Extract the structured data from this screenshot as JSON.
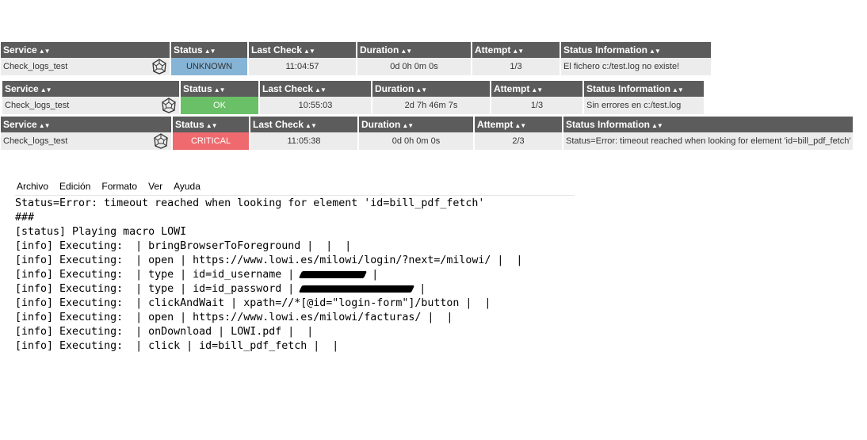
{
  "headers": {
    "service": "Service",
    "status": "Status",
    "last_check": "Last Check",
    "duration": "Duration",
    "attempt": "Attempt",
    "status_info": "Status Information"
  },
  "rows": [
    {
      "service": "Check_logs_test",
      "status": "UNKNOWN",
      "status_color": "#86b4d6",
      "last_check": "11:04:57",
      "duration": "0d 0h 0m 0s",
      "attempt": "1/3",
      "status_info": "El fichero c:/test.log no existe!"
    },
    {
      "service": "Check_logs_test",
      "status": "OK",
      "status_color": "#6ac066",
      "last_check": "10:55:03",
      "duration": "2d 7h 46m 7s",
      "attempt": "1/3",
      "status_info": "Sin errores en c:/test.log"
    },
    {
      "service": "Check_logs_test",
      "status": "CRITICAL",
      "status_color": "#ef6a6e",
      "last_check": "11:05:38",
      "duration": "0d 0h 0m 0s",
      "attempt": "2/3",
      "status_info": "Status=Error: timeout reached when looking for element 'id=bill_pdf_fetch'"
    }
  ],
  "notepad": {
    "menu": [
      "Archivo",
      "Edición",
      "Formato",
      "Ver",
      "Ayuda"
    ],
    "lines": [
      "Status=Error: timeout reached when looking for element 'id=bill_pdf_fetch'",
      "###",
      "[status] Playing macro LOWI",
      "[info] Executing:  | bringBrowserToForeground |  |  |",
      "[info] Executing:  | open | https://www.lowi.es/milowi/login/?next=/milowi/ |  |",
      "[info] Executing:  | type | id=id_username | ",
      "[info] Executing:  | type | id=id_password | ",
      "[info] Executing:  | clickAndWait | xpath=//*[@id=\"login-form\"]/button |  |",
      "[info] Executing:  | open | https://www.lowi.es/milowi/facturas/ |  |",
      "[info] Executing:  | onDownload | LOWI.pdf |  |",
      "[info] Executing:  | click | id=bill_pdf_fetch |  |"
    ],
    "line6_tail": "|",
    "line7_tail": "|"
  }
}
